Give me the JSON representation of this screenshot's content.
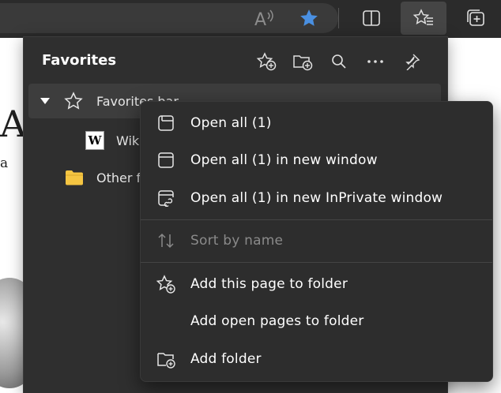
{
  "toolbar": {
    "read_aloud_icon": "read-aloud-icon",
    "favorite_star_icon": "star-filled-icon",
    "split_screen_icon": "split-screen-icon",
    "favorites_icon": "favorites-icon",
    "collections_icon": "collections-icon",
    "accent": "#4a90e2"
  },
  "page": {
    "big_letter": "A",
    "small_letter": "a"
  },
  "favorites_panel": {
    "title": "Favorites",
    "tools": [
      "add-favorite-icon",
      "add-folder-icon",
      "search-icon",
      "more-icon",
      "pin-icon"
    ],
    "tree": {
      "favorites_bar": "Favorites bar",
      "wiki_item": "Wik",
      "wiki_favicon": "W",
      "other": "Other f"
    }
  },
  "context_menu": {
    "items": [
      {
        "label": "Open all (1)",
        "icon": "tab-icon"
      },
      {
        "label": "Open all (1) in new window",
        "icon": "window-icon"
      },
      {
        "label": "Open all (1) in new InPrivate window",
        "icon": "inprivate-window-icon"
      },
      {
        "label": "Sort by name",
        "icon": "sort-icon",
        "disabled": true
      },
      {
        "label": "Add this page to folder",
        "icon": "star-add-icon"
      },
      {
        "label": "Add open pages to folder",
        "icon": ""
      },
      {
        "label": "Add folder",
        "icon": "folder-add-icon"
      }
    ]
  },
  "colors": {
    "panel_bg": "#2f2f2f",
    "menu_bg": "#2d2d2d",
    "folder_yellow": "#f5c542"
  }
}
